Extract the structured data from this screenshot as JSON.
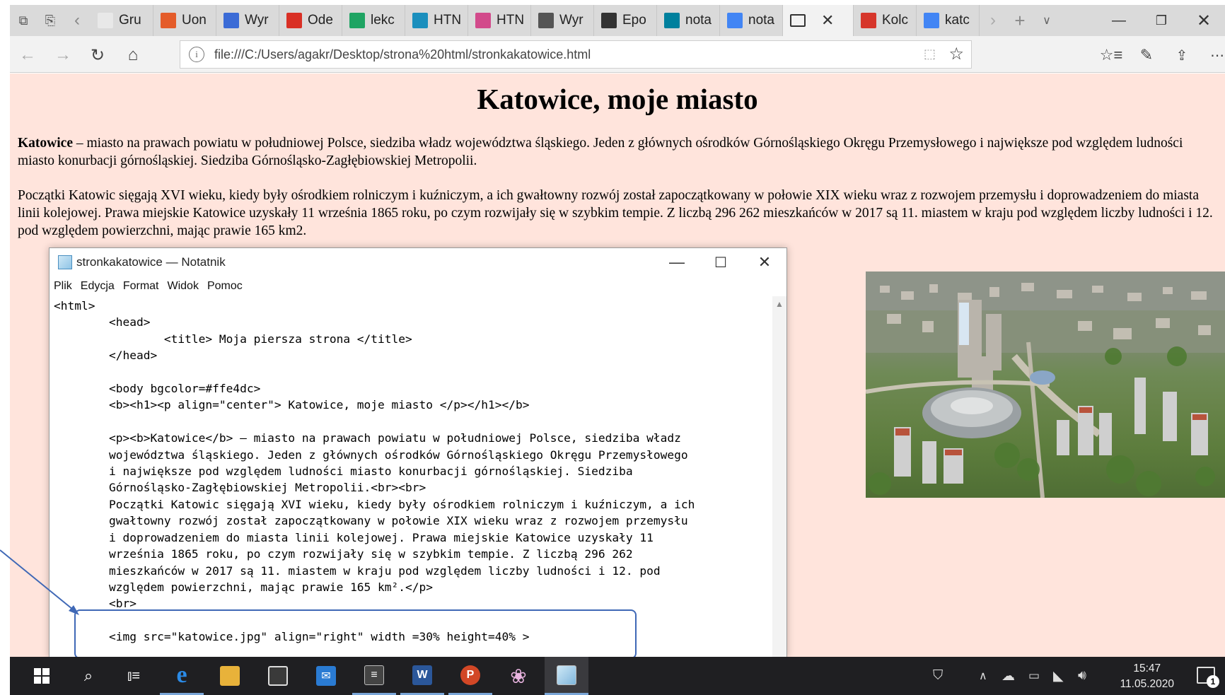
{
  "browser": {
    "tabs": [
      {
        "label": "Gru",
        "icon": "tab-collection-icon",
        "color": "#e8e8e8"
      },
      {
        "label": "Uon",
        "icon": "office-icon",
        "color": "#e45c2a"
      },
      {
        "label": "Wyr",
        "icon": "contact-card-icon",
        "color": "#3b6bd6"
      },
      {
        "label": "Ode",
        "icon": "gmail-icon",
        "color": "#d93025"
      },
      {
        "label": "lekc",
        "icon": "drive-icon",
        "color": "#1fa463"
      },
      {
        "label": "HTN",
        "icon": "parrot-icon",
        "color": "#1b8fbd"
      },
      {
        "label": "HTN",
        "icon": "puzzle-icon",
        "color": "#d24a8b"
      },
      {
        "label": "Wyr",
        "icon": "wikipedia-icon",
        "color": "#555555"
      },
      {
        "label": "Epo",
        "icon": "book-icon",
        "color": "#333333"
      },
      {
        "label": "nota",
        "icon": "bing-icon",
        "color": "#00809d"
      },
      {
        "label": "nota",
        "icon": "google-icon",
        "color": "#4285f4"
      },
      {
        "label": "",
        "icon": "page-icon",
        "color": "#333333",
        "active": true
      },
      {
        "label": "Kolc",
        "icon": "pdf-icon",
        "color": "#d6362b"
      },
      {
        "label": "katc",
        "icon": "google-icon",
        "color": "#4285f4"
      }
    ],
    "url": "file:///C:/Users/agakr/Desktop/strona%20html/stronkakatowice.html"
  },
  "page": {
    "heading": "Katowice, moje miasto",
    "p1_bold": "Katowice",
    "p1_rest": " – miasto na prawach powiatu w południowej Polsce, siedziba władz województwa śląskiego. Jeden z głównych ośrodków Górnośląskiego Okręgu Przemysłowego i największe pod względem ludności miasto konurbacji górnośląskiej. Siedziba Górnośląsko-Zagłębiowskiej Metropolii.",
    "p2": "Początki Katowic sięgają XVI wieku, kiedy były ośrodkiem rolniczym i kuźniczym, a ich gwałtowny rozwój został zapoczątkowany w połowie XIX wieku wraz z rozwojem przemysłu i doprowadzeniem do miasta linii kolejowej. Prawa miejskie Katowice uzyskały 11 września 1865 roku, po czym rozwijały się w szybkim tempie. Z liczbą 296 262 mieszkańców w 2017 są 11. miastem w kraju pod względem liczby ludności i 12. pod względem powierzchni, mając prawie 165 km2."
  },
  "notepad": {
    "title": "stronkakatowice — Notatnik",
    "menu": [
      "Plik",
      "Edycja",
      "Format",
      "Widok",
      "Pomoc"
    ],
    "code": "<html>\n        <head>\n                <title> Moja piersza strona </title>\n        </head>\n\n        <body bgcolor=#ffe4dc>\n        <b><h1><p align=\"center\"> Katowice, moje miasto </p></h1></b>\n\n        <p><b>Katowice</b> – miasto na prawach powiatu w południowej Polsce, siedziba władz\n        województwa śląskiego. Jeden z głównych ośrodków Górnośląskiego Okręgu Przemysłowego\n        i największe pod względem ludności miasto konurbacji górnośląskiej. Siedziba\n        Górnośląsko-Zagłębiowskiej Metropolii.<br><br>\n        Początki Katowic sięgają XVI wieku, kiedy były ośrodkiem rolniczym i kuźniczym, a ich\n        gwałtowny rozwój został zapoczątkowany w połowie XIX wieku wraz z rozwojem przemysłu\n        i doprowadzeniem do miasta linii kolejowej. Prawa miejskie Katowice uzyskały 11\n        września 1865 roku, po czym rozwijały się w szybkim tempie. Z liczbą 296 262\n        mieszkańców w 2017 są 11. miastem w kraju pod względem liczby ludności i 12. pod\n        względem powierzchni, mając prawie 165 km².</p>\n        <br>\n\n        <img src=\"katowice.jpg\" align=\"right\" width =30% height=40% >"
  },
  "taskbar": {
    "time": "15:47",
    "date": "11.05.2020",
    "notifications": "1"
  },
  "colors": {
    "page_background": "#ffe4dc",
    "callout_border": "#3f68b6",
    "taskbar": "#1f1f22"
  }
}
